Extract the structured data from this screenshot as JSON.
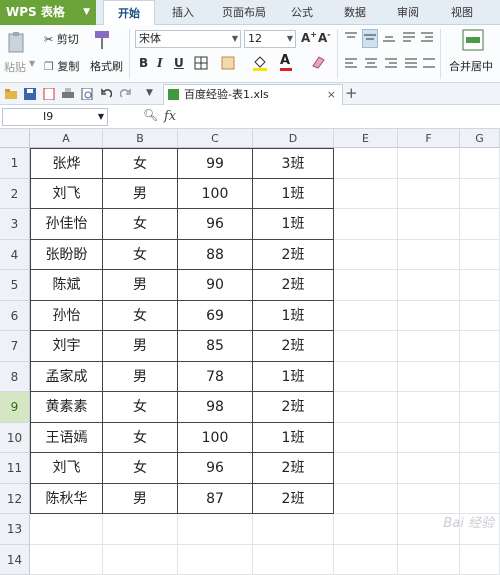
{
  "app": {
    "name": "WPS 表格"
  },
  "tabs": [
    {
      "label": "开始",
      "active": true
    },
    {
      "label": "插入",
      "active": false
    },
    {
      "label": "页面布局",
      "active": false
    },
    {
      "label": "公式",
      "active": false
    },
    {
      "label": "数据",
      "active": false
    },
    {
      "label": "审阅",
      "active": false
    },
    {
      "label": "视图",
      "active": false
    }
  ],
  "ribbon": {
    "paste": "粘贴",
    "cut": "剪切",
    "copy": "复制",
    "format_painter": "格式刷",
    "font_name": "宋体",
    "font_size": "12",
    "merge": "合并居中"
  },
  "doc": {
    "tab_title": "百度经验-表1.xls",
    "close": "×",
    "new_tab": "+"
  },
  "formula_bar": {
    "cell_ref": "I9",
    "fx": "fx"
  },
  "columns": [
    "A",
    "B",
    "C",
    "D",
    "E",
    "F",
    "G"
  ],
  "rows": [
    {
      "num": "1",
      "cells": [
        "张烨",
        "女",
        "99",
        "3班"
      ]
    },
    {
      "num": "2",
      "cells": [
        "刘飞",
        "男",
        "100",
        "1班"
      ]
    },
    {
      "num": "3",
      "cells": [
        "孙佳怡",
        "女",
        "96",
        "1班"
      ]
    },
    {
      "num": "4",
      "cells": [
        "张盼盼",
        "女",
        "88",
        "2班"
      ]
    },
    {
      "num": "5",
      "cells": [
        "陈斌",
        "男",
        "90",
        "2班"
      ]
    },
    {
      "num": "6",
      "cells": [
        "孙怡",
        "女",
        "69",
        "1班"
      ]
    },
    {
      "num": "7",
      "cells": [
        "刘宇",
        "男",
        "85",
        "2班"
      ]
    },
    {
      "num": "8",
      "cells": [
        "孟家成",
        "男",
        "78",
        "1班"
      ]
    },
    {
      "num": "9",
      "cells": [
        "黄素素",
        "女",
        "98",
        "2班"
      ]
    },
    {
      "num": "10",
      "cells": [
        "王语嫣",
        "女",
        "100",
        "1班"
      ]
    },
    {
      "num": "11",
      "cells": [
        "刘飞",
        "女",
        "96",
        "2班"
      ]
    },
    {
      "num": "12",
      "cells": [
        "陈秋华",
        "男",
        "87",
        "2班"
      ]
    },
    {
      "num": "13",
      "cells": [
        "",
        "",
        "",
        ""
      ]
    },
    {
      "num": "14",
      "cells": [
        "",
        "",
        "",
        ""
      ]
    }
  ],
  "selected_row": "9",
  "watermark": "Bai 经验",
  "colors": {
    "accent": "#6aa33a",
    "selected_row_header": "#d6e6c2"
  }
}
